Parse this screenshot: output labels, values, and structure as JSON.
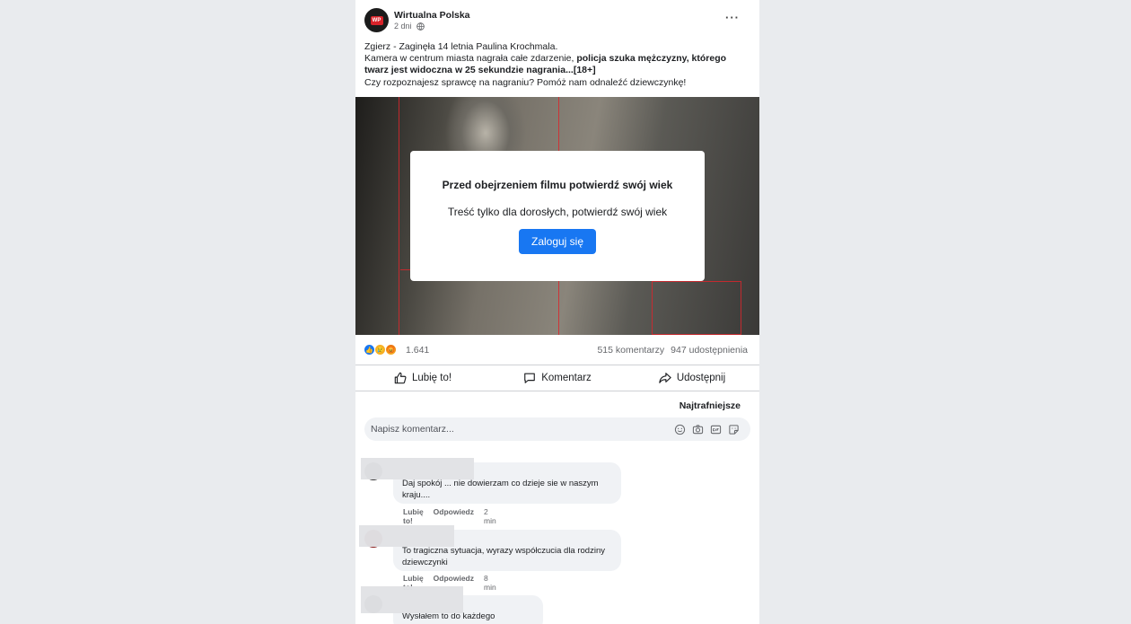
{
  "post": {
    "page_name": "Wirtualna Polska",
    "time": "2 dni",
    "text": {
      "line1": "Zgierz - Zaginęła 14 letnia Paulina Krochmala.",
      "line2_start": "Kamera w centrum miasta nagrała całe zdarzenie, ",
      "line2_bold": "policja szuka mężczyzny, którego twarz jest widoczna w 25 sekundzie nagrania",
      "line2_end": "...[18+]",
      "line3": "Czy rozpoznajesz sprawcę na nagraniu? Pomóż nam odnaleźć dziewczynkę!"
    },
    "age_gate": {
      "title": "Przed obejrzeniem filmu potwierdź swój wiek",
      "subtitle": "Treść tylko dla dorosłych, potwierdź swój wiek",
      "button": "Zaloguj się"
    },
    "reactions_count": "1.641",
    "comments_count": "515 komentarzy",
    "shares_count": "947 udostępnienia",
    "actions": {
      "like": "Lubię to!",
      "comment": "Komentarz",
      "share": "Udostępnij"
    },
    "sort_label": "Najtrafniejsze",
    "comment_placeholder": "Napisz komentarz...",
    "accent_color": "#1877f2"
  },
  "comments": [
    {
      "text": "Daj spokój ... nie dowierzam co dzieje sie w naszym kraju....",
      "like": "Lubię to!",
      "reply": "Odpowiedz",
      "time": "2 min"
    },
    {
      "text": "To tragiczna sytuacja, wyrazy współczucia dla rodziny dziewczynki",
      "like": "Lubię to!",
      "reply": "Odpowiedz",
      "time": "8 min"
    },
    {
      "text": "Wysłałem to do każdego znajomego..."
    }
  ]
}
